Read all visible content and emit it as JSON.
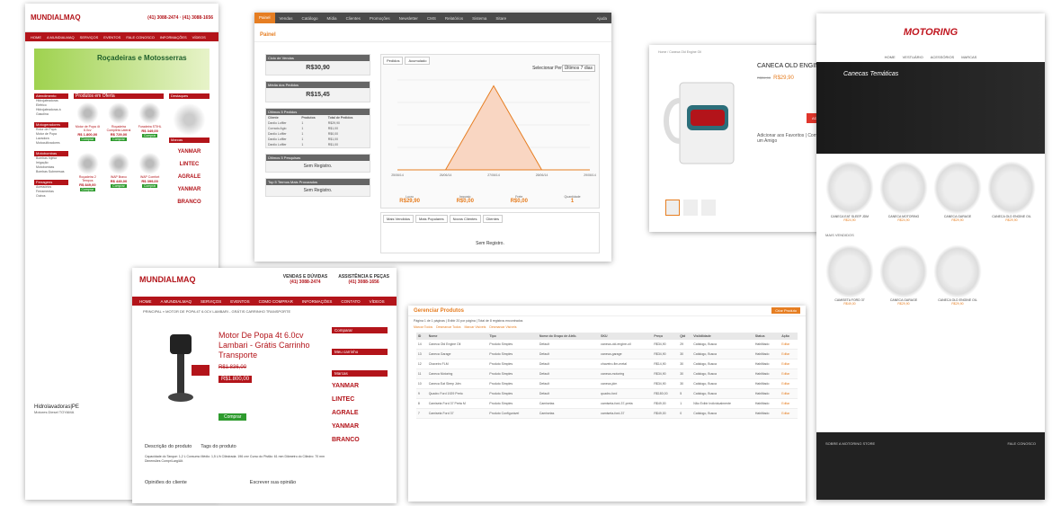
{
  "card1": {
    "logo": "MUNDIALMAQ",
    "phones": "(41) 3088-2474 · (41) 3088-1656",
    "nav": [
      "HOME",
      "A MUNDIALMAQ",
      "SERVIÇOS",
      "EVENTOS",
      "FALE CONOSCO",
      "INFORMAÇÕES",
      "VÍDEOS"
    ],
    "banner": "Roçadeiras e Motosserras",
    "sidebar": [
      {
        "title": "Atendimento",
        "items": [
          "Hidrojateadoras Elétrico",
          "Hidrojateadoras à Gasolina"
        ]
      },
      {
        "title": "Motogeradores",
        "items": [
          "Rotor de Popa",
          "Motor de Popa",
          "Lavadora",
          "Motocultivadores"
        ]
      },
      {
        "title": "Motobombas",
        "items": [
          "Bombas Injetor",
          "Irrigação",
          "Motobombas",
          "Bombas Submersas"
        ]
      },
      {
        "title": "Ferragens",
        "items": [
          "Acessórios",
          "Ferramentas",
          "Outros"
        ]
      }
    ],
    "products_title": "Produtos em Oferta",
    "products": [
      {
        "name": "Motor de Popa 4t 6.0cv",
        "price": "R$ 1.800,00",
        "btn": "Comprar"
      },
      {
        "name": "Roçadeira Completa Lateral",
        "price": "R$ 729,00",
        "btn": "Comprar"
      },
      {
        "name": "Furadeira STIHL",
        "price": "R$ 349,00",
        "btn": "Comprar"
      },
      {
        "name": "Roçadeira 2 Tempos",
        "price": "R$ 849,00",
        "btn": "Comprar"
      },
      {
        "name": "WAP Bravo",
        "price": "R$ 449,00",
        "btn": "Comprar"
      },
      {
        "name": "WAP Comfort",
        "price": "R$ 399,00",
        "btn": "Comprar"
      }
    ],
    "right": {
      "destaque": "Destaques",
      "brands_title": "Marcas",
      "brands": [
        "YANMAR",
        "LINTEC",
        "AGRALE",
        "YANMAR",
        "BRANCO"
      ]
    },
    "footer": {
      "title": "Hidrolavadoras|PE",
      "text": "Motores Diesel TOYAMA"
    }
  },
  "card2": {
    "menu": [
      "Painel",
      "Vendas",
      "Catálogo",
      "Mídia",
      "Clientes",
      "Promoções",
      "Newsletter",
      "CMS",
      "Relatórios",
      "Sistema",
      "Sitare"
    ],
    "active": "Painel",
    "help": "Ajuda",
    "title": "Painel",
    "stats": [
      {
        "label": "Ciclo de Vendas",
        "value": "R$30,90"
      },
      {
        "label": "Média dos Pedidos",
        "value": "R$15,45"
      }
    ],
    "last_orders_title": "Últimos 5 Pedidos",
    "last_orders_cols": [
      "Cliente",
      "Produtos",
      "Total de Pedidos"
    ],
    "last_orders": [
      [
        "Danilo Loffler",
        "1",
        "R$29,90"
      ],
      [
        "Corrado Agio",
        "1",
        "R$1,00"
      ],
      [
        "Danilo Loffler",
        "1",
        "R$0,00"
      ],
      [
        "Danilo Loffler",
        "1",
        "R$1,00"
      ],
      [
        "Danilo Loffler",
        "1",
        "R$1,00"
      ]
    ],
    "searches_title": "Últimos 5 Pesquisas",
    "no_records": "Sem Registro.",
    "terms_title": "Top 5 Termos Mais Procurados",
    "chart_tabs": [
      "Pedidos",
      "Acumulado"
    ],
    "period_label": "Selecionar Período:",
    "period_value": "Últimos 7 dias",
    "metrics": [
      {
        "label": "Lucro",
        "value": "R$29,90"
      },
      {
        "label": "Imposto",
        "value": "R$0,00"
      },
      {
        "label": "Frete",
        "value": "R$0,00"
      },
      {
        "label": "Quantidade",
        "value": "1"
      }
    ],
    "bottom_tabs": [
      "Mais Vendidos",
      "Mais Populares",
      "Novos Clientes",
      "Clientes"
    ],
    "chart_data": {
      "type": "area",
      "x": [
        "25/06/14",
        "26/06/14",
        "27/06/14",
        "28/06/14",
        "29/06/14"
      ],
      "values": [
        0,
        0,
        29.9,
        0,
        0
      ],
      "ylim": [
        0,
        32
      ]
    }
  },
  "card3": {
    "breadcrumb": "Home / Caneca Old Engine Oil",
    "name": "CANECA OLD ENGINE OIL",
    "old_price": "R$34,90",
    "price": "R$29,90",
    "add_label": "ADD AO CARRINHO",
    "links": "Adicionar aos Favoritos | Compare Produto | Enviar um Amigo"
  },
  "card4": {
    "logo": "MOTORING",
    "nav": [
      "HOME",
      "VESTUÁRIO",
      "ACESSÓRIOS",
      "MARCAS"
    ],
    "hero": "Canecas Temáticas",
    "products": [
      {
        "name": "CANECA EAT SLEEP JDM",
        "price": "R$24,90"
      },
      {
        "name": "CANECA MOTORING",
        "price": "R$24,90"
      },
      {
        "name": "CANECA GARAGE",
        "price": "R$29,90"
      },
      {
        "name": "CANECA OLD ENGINE OIL",
        "price": "R$29,90"
      }
    ],
    "section": "MAIS VENDIDOS",
    "products2": [
      {
        "name": "CAMISETA FORD 37",
        "price": "R$49,00"
      },
      {
        "name": "CANECA GARAGE",
        "price": "R$29,90"
      },
      {
        "name": "CANECA OLD ENGINE OIL",
        "price": "R$29,90"
      }
    ],
    "footer_title": "SOBRE A MOTORING STORE",
    "footer_contact": "FALE CONOSCO"
  },
  "card5": {
    "logo": "MUNDIALMAQ",
    "phone1_label": "VENDAS E DÚVIDAS",
    "phone1": "(41) 3088-2474",
    "phone2_label": "ASSISTÊNCIA E PEÇAS",
    "phone2": "(41) 3088-1656",
    "nav": [
      "HOME",
      "A MUNDIALMAQ",
      "SERVIÇOS",
      "EVENTOS",
      "COMO COMPRAR",
      "INFORMAÇÕES",
      "CONTATO",
      "VÍDEOS"
    ],
    "breadcrumb": "PRINCIPAL » MOTOR DE POPA 4T 6.0CV LAMBARI - GRÁTIS CARRINHO TRANSPORTE",
    "title": "Motor De Popa 4t 6.0cv Lambari - Grátis Carrinho Transporte",
    "old_price": "R$1.836,00",
    "price": "R$1.800,00",
    "buy": "Comprar",
    "compare": "Comparar",
    "cart": "Meu carrinho",
    "brands_title": "Marcas",
    "brands": [
      "YANMAR",
      "LINTEC",
      "AGRALE",
      "YANMAR",
      "BRANCO"
    ],
    "tab1": "Descrição do produto",
    "tab2": "Tags do produto",
    "desc": "Capacidade do Tanque: 1,2 L Consumo Médio: 1,5 L/h Cilindrada: 196 cm³ Curso do Pistão: 61 mm Diâmetro do Cilindro: 70 mm Dimensões Compr/Larg/Alt.",
    "opinions": "Opiniões do cliente",
    "write": "Escrever sua opinião"
  },
  "card6": {
    "title": "Gerenciar Produtos",
    "new_btn": "Criar Produto",
    "pager": "Página 1 de 1 páginas | Exibir 20 por página | Total de 8 registros encontrados",
    "tabs": [
      "Marcar Todos",
      "Desmarcar Todos",
      "Marcar Visíveis",
      "Desmarcar Visíveis"
    ],
    "cols": [
      "ID",
      "Nome",
      "Tipo",
      "Nome do Grupo de Atrib.",
      "SKU",
      "Preço",
      "Qtd",
      "Visibilidade",
      "Status",
      "Ação"
    ],
    "rows": [
      [
        "14",
        "Caneca Old Engine Oil",
        "Produto Simples",
        "Default",
        "caneca-old-engine-oil",
        "R$34,90",
        "29",
        "Catálogo, Busca",
        "Habilitado",
        "Editar"
      ],
      [
        "13",
        "Caneca Garage",
        "Produto Simples",
        "Default",
        "caneca-garage",
        "R$34,90",
        "30",
        "Catálogo, Busca",
        "Habilitado",
        "Editar"
      ],
      [
        "12",
        "Chaveiro FLM",
        "Produto Simples",
        "Default",
        "chaveiro-flm-metal",
        "R$14,90",
        "30",
        "Catálogo, Busca",
        "Habilitado",
        "Editar"
      ],
      [
        "11",
        "Caneca Motoring",
        "Produto Simples",
        "Default",
        "caneca-motoring",
        "R$34,90",
        "30",
        "Catálogo, Busca",
        "Habilitado",
        "Editar"
      ],
      [
        "10",
        "Caneca Eat Sleep Jdm",
        "Produto Simples",
        "Default",
        "caneca-jdm",
        "R$34,90",
        "30",
        "Catálogo, Busca",
        "Habilitado",
        "Editar"
      ],
      [
        "9",
        "Quadro Ford 1929 Preto",
        "Produto Simples",
        "Default",
        "quadro-ford",
        "R$180,00",
        "5",
        "Catálogo, Busca",
        "Habilitado",
        "Editar"
      ],
      [
        "8",
        "Camiseta Ford 37 Preta M",
        "Produto Simples",
        "Camisetas",
        "camiseta-ford-37-preta",
        "R$49,00",
        "1",
        "Não Exibir Individualmente",
        "Habilitado",
        "Editar"
      ],
      [
        "7",
        "Camiseta Ford 37",
        "Produto Configurável",
        "Camisetas",
        "camiseta-ford-37",
        "R$49,00",
        "0",
        "Catálogo, Busca",
        "Habilitado",
        "Editar"
      ]
    ]
  }
}
